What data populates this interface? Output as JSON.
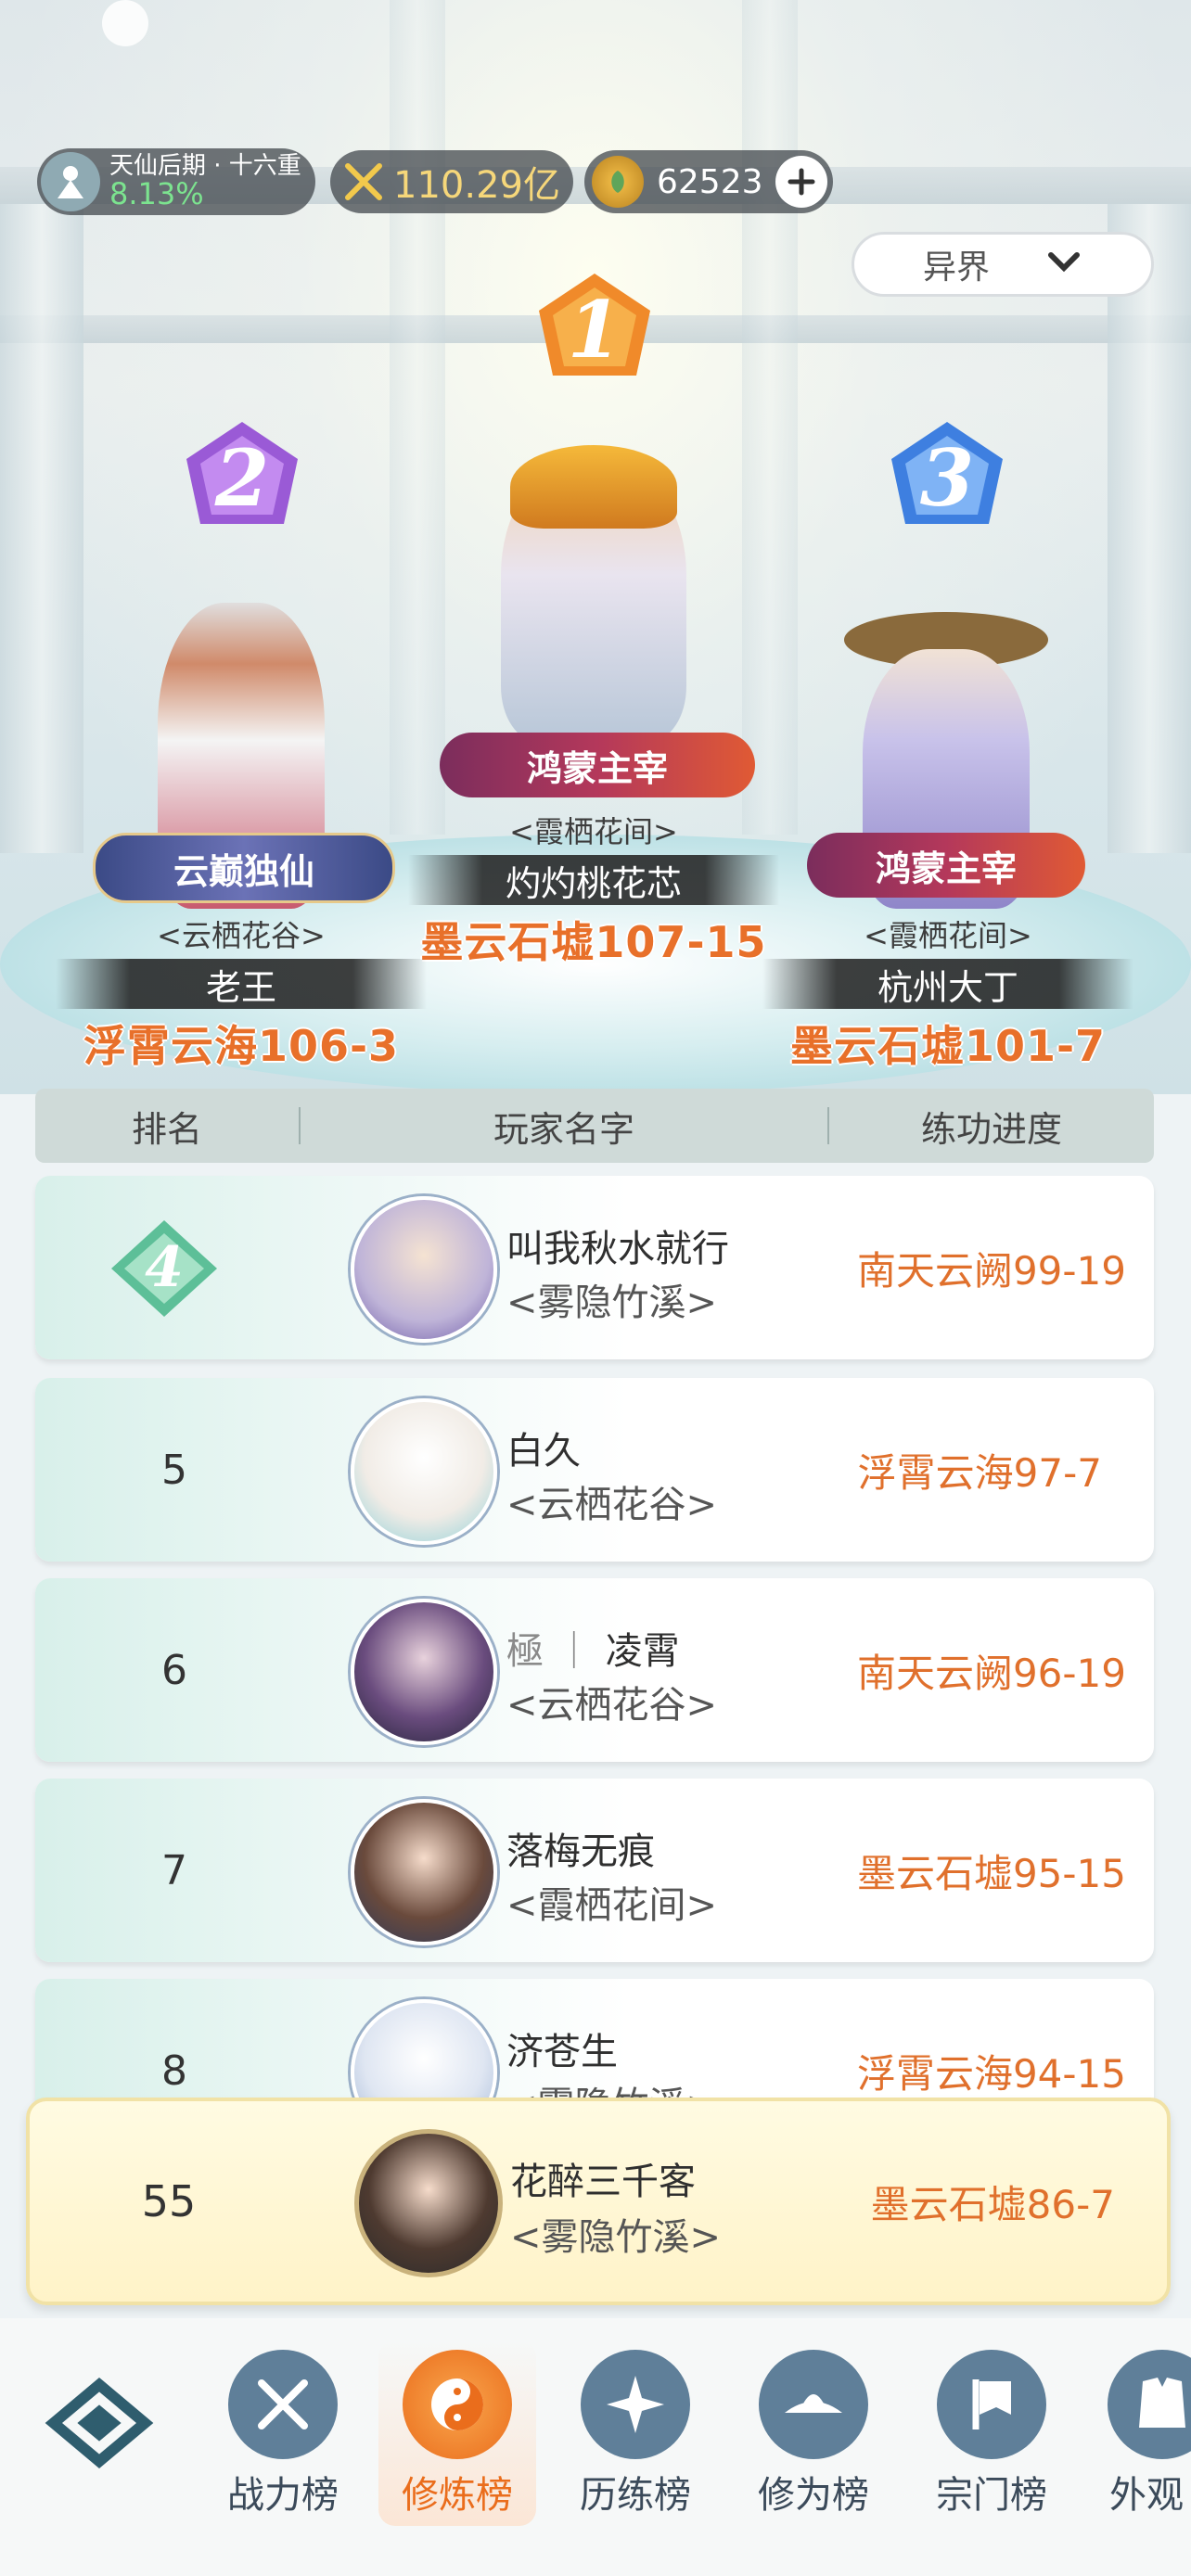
{
  "top_bar": {
    "realm": "天仙后期 · 十六重",
    "realm_percent": "8.13%",
    "power": "110.29亿",
    "currency": "62523",
    "add_icon": "plus-icon"
  },
  "server_filter": {
    "selected": "异界"
  },
  "podium": [
    {
      "rank": "1",
      "title": "鸿蒙主宰",
      "guild": "<霞栖花间>",
      "name": "灼灼桃花芯",
      "progress": "墨云石墟107-15"
    },
    {
      "rank": "2",
      "title": "云巅独仙",
      "guild": "<云栖花谷>",
      "name": "老王",
      "progress": "浮霄云海106-3"
    },
    {
      "rank": "3",
      "title": "鸿蒙主宰",
      "guild": "<霞栖花间>",
      "name": "杭州大丁",
      "progress": "墨云石墟101-7"
    }
  ],
  "table": {
    "headers": [
      "排名",
      "玩家名字",
      "练功进度"
    ],
    "rows": [
      {
        "rank": "4",
        "name": "叫我秋水就行",
        "guild": "<雾隐竹溪>",
        "progress": "南天云阙99-19"
      },
      {
        "rank": "5",
        "name": "白久",
        "guild": "<云栖花谷>",
        "progress": "浮霄云海97-7"
      },
      {
        "rank": "6",
        "name_prefix": "極 ｜",
        "name": "凌霄",
        "guild": "<云栖花谷>",
        "progress": "南天云阙96-19"
      },
      {
        "rank": "7",
        "name": "落梅无痕",
        "guild": "<霞栖花间>",
        "progress": "墨云石墟95-15"
      },
      {
        "rank": "8",
        "name": "济苍生",
        "guild": "<雾隐竹溪>",
        "progress": "浮霄云海94-15"
      }
    ],
    "self": {
      "rank": "55",
      "name": "花醉三千客",
      "guild": "<雾隐竹溪>",
      "progress": "墨云石墟86-7"
    }
  },
  "nav": {
    "items": [
      {
        "label": "",
        "icon": "menu-diamond-icon"
      },
      {
        "label": "战力榜",
        "icon": "sword-icon"
      },
      {
        "label": "修炼榜",
        "icon": "yin-yang-icon",
        "active": true
      },
      {
        "label": "历练榜",
        "icon": "star-compass-icon"
      },
      {
        "label": "修为榜",
        "icon": "hat-icon"
      },
      {
        "label": "宗门榜",
        "icon": "banner-icon"
      },
      {
        "label": "外观",
        "icon": "outfit-icon"
      }
    ]
  },
  "colors": {
    "progress_orange": "#e0702c",
    "active_nav": "#f08a2a",
    "podium_platform": "#b9dfe4"
  }
}
